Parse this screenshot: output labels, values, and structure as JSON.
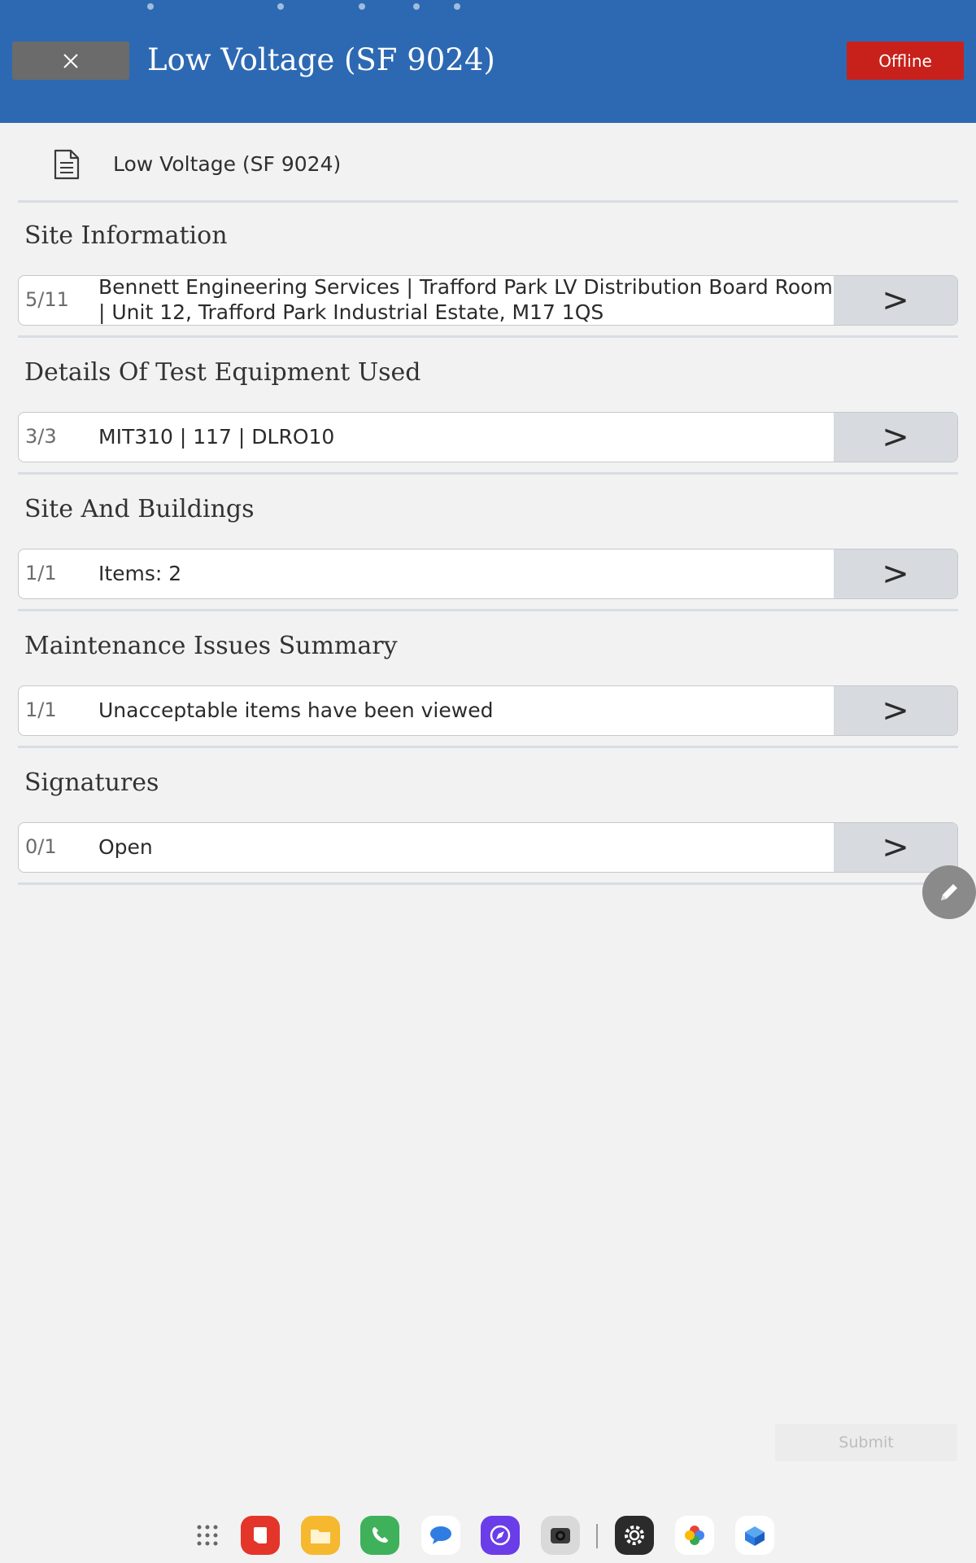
{
  "header": {
    "title": "Low Voltage (SF 9024)",
    "status_badge": "Offline",
    "accent_color": "#2d69b3",
    "badge_color": "#c8211b"
  },
  "form": {
    "title": "Low Voltage (SF 9024)",
    "icon": "document-icon"
  },
  "sections": [
    {
      "heading": "Site Information",
      "count": "5/11",
      "summary_line1": "Bennett Engineering Services | Trafford Park LV Distribution Board Room",
      "summary_line2": "| Unit 12, Trafford Park Industrial Estate, M17 1QS",
      "arrow": ">"
    },
    {
      "heading": "Details Of Test Equipment Used",
      "count": "3/3",
      "summary_line1": "MIT310 | 117 | DLRO10",
      "arrow": ">"
    },
    {
      "heading": "Site And Buildings",
      "count": "1/1",
      "summary_line1": "Items: 2",
      "arrow": ">"
    },
    {
      "heading": "Maintenance Issues Summary",
      "count": "1/1",
      "summary_line1": "Unacceptable items have been viewed",
      "arrow": ">"
    },
    {
      "heading": "Signatures",
      "count": "0/1",
      "summary_line1": "Open",
      "arrow": ">"
    }
  ],
  "actions": {
    "submit_label": "Submit",
    "edit_icon": "pencil-icon"
  },
  "dock": {
    "apps": [
      "apps-grid-icon",
      "notes-app-icon",
      "files-app-icon",
      "phone-app-icon",
      "messages-app-icon",
      "browser-app-icon",
      "camera-app-icon",
      "settings-app-icon",
      "photos-app-icon",
      "store-app-icon"
    ]
  }
}
